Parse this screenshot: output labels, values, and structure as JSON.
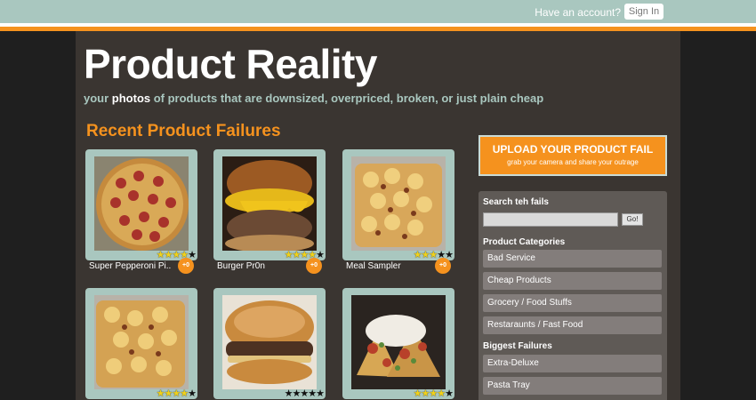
{
  "header": {
    "account_prompt": "Have an account?",
    "signin_label": "Sign In"
  },
  "site": {
    "title": "Product Reality",
    "tagline_pre": "your ",
    "tagline_bold": "photos",
    "tagline_post": " of products that are downsized, overpriced, broken, or just plain cheap"
  },
  "recent": {
    "heading": "Recent Product Failures",
    "items": [
      {
        "name": "Super Pepperoni Pi..",
        "rating": 4,
        "badge": "+0",
        "image": "pizza"
      },
      {
        "name": "Burger Pr0n",
        "rating": 4,
        "badge": "+0",
        "image": "burger-cheese"
      },
      {
        "name": "Meal Sampler",
        "rating": 3,
        "badge": "+0",
        "image": "pasta-tray"
      },
      {
        "name": "",
        "rating": 4,
        "badge": "",
        "image": "pasta-tray"
      },
      {
        "name": "",
        "rating": 0,
        "badge": "",
        "image": "hamburger"
      },
      {
        "name": "",
        "rating": 4,
        "badge": "",
        "image": "nachos"
      }
    ]
  },
  "upload": {
    "title": "UPLOAD YOUR PRODUCT FAIL",
    "subtitle": "grab your camera and share your outrage"
  },
  "sidebar": {
    "search_heading": "Search teh fails",
    "search_value": "",
    "go_label": "Go!",
    "categories_heading": "Product Categories",
    "categories": [
      "Bad Service",
      "Cheap Products",
      "Grocery / Food Stuffs",
      "Restaraunts / Fast Food"
    ],
    "biggest_heading": "Biggest Failures",
    "biggest": [
      "Extra-Deluxe",
      "Pasta Tray"
    ]
  },
  "colors": {
    "accent": "#f5921e",
    "teal": "#a9c7bf",
    "panel": "#3a3531",
    "sidebar": "#5f5a56"
  }
}
